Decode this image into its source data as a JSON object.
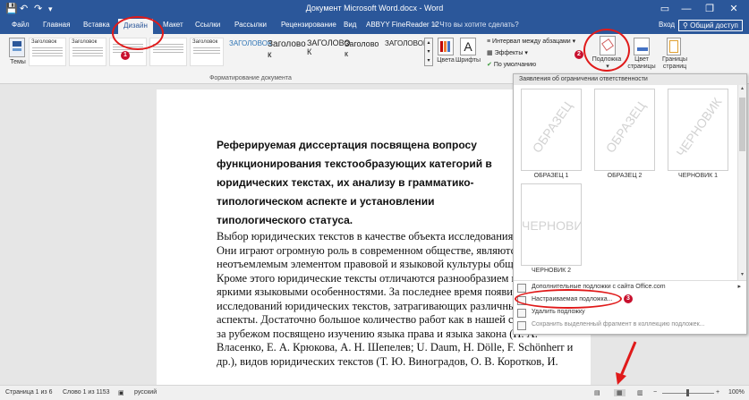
{
  "window": {
    "title": "Документ Microsoft Word.docx - Word",
    "controls": {
      "minimize": "—",
      "restore": "❐",
      "close": "✕"
    },
    "qa_save": "💾",
    "qa_undo": "↶",
    "qa_redo": "↷",
    "qa_more": "▾"
  },
  "tabs": [
    "Файл",
    "Главная",
    "Вставка",
    "Дизайн",
    "Макет",
    "Ссылки",
    "Рассылки",
    "Рецензирование",
    "Вид",
    "ABBYY FineReader 12"
  ],
  "tell_me": "Что вы хотите сделать?",
  "sign_in": "Вход",
  "share": "Общий доступ",
  "ribbon": {
    "themes_label": "Темы",
    "style_samples": [
      "Заголовок",
      "Заголовок",
      "",
      "",
      "",
      "",
      "Заголовок"
    ],
    "style_large": [
      "ЗАГОЛОВОК",
      "Заголово",
      "Заголово",
      "ЗАГОЛОВО",
      "ЗАГОЛОВОК"
    ],
    "style_large_2": [
      "",
      "к",
      "к",
      "К",
      ""
    ],
    "colors_label": "Цвета",
    "fonts_label": "Шрифты",
    "paragraph_spacing": "Интервал между абзацами",
    "effects": "Эффекты",
    "set_default": "По умолчанию",
    "watermark": "Подложка",
    "page_color": "Цвет",
    "page_color_2": "страницы",
    "page_borders": "Границы",
    "page_borders_2": "страниц",
    "group_caption": "Форматирование документа"
  },
  "document": {
    "heading": "Реферируемая диссертация посвящена вопросу функционирования текстообразующих категорий в юридических текстах, их анализу в грамматико-типологическом аспекте и установлении типологического статуса.",
    "body": "Выбор юридических текстов в качестве объекта исследования не случаен. Они играют огромную роль в современном обществе, являются неотъемлемым элементом правовой и языковой культуры общества. Кроме этого юридические тексты отличаются разнообразием видов и яркими языковыми особенностями. За последнее время появилось немало исследований юридических текстов, затрагивающих различные их аспекты. Достаточно большое количество работ как в нашей стране, так и за рубежом посвящено изучению языка права и языка закона (Н. А. Власенко, Е. А. Крюкова, А. Н. Шепелев; U. Daum, H. Dölle, F. Schönherr и др.), видов юридических текстов (Т. Ю. Виноградов, О. В. Коротков, И."
  },
  "watermark_menu": {
    "header": "Заявления об ограничении ответственности",
    "thumbs": [
      {
        "text": "ОБРАЗЕЦ",
        "caption": "ОБРАЗЕЦ 1",
        "diagonal": true
      },
      {
        "text": "ОБРАЗЕЦ",
        "caption": "ОБРАЗЕЦ 2",
        "diagonal": true
      },
      {
        "text": "ЧЕРНОВИК",
        "caption": "ЧЕРНОВИК 1",
        "diagonal": true
      },
      {
        "text": "ЧЕРНОВИК",
        "caption": "ЧЕРНОВИК 2",
        "diagonal": false
      }
    ],
    "items": [
      {
        "label": "Дополнительные подложки с сайта Office.com",
        "dim": false,
        "arrow": "▸"
      },
      {
        "label": "Настраиваемая подложка...",
        "dim": false,
        "arrow": ""
      },
      {
        "label": "Удалить подложку",
        "dim": false,
        "arrow": ""
      },
      {
        "label": "Сохранить выделенный фрагмент в коллекцию подложек...",
        "dim": true,
        "arrow": ""
      }
    ]
  },
  "status": {
    "page": "Страница 1 из 6",
    "words": "Слово 1 из 1153",
    "lang": "русский",
    "zoom": "100%"
  },
  "annotations": {
    "n1": "1",
    "n2": "2",
    "n3": "3"
  },
  "colors": {
    "brand": "#2b579a",
    "annotation": "#e01a1a"
  }
}
